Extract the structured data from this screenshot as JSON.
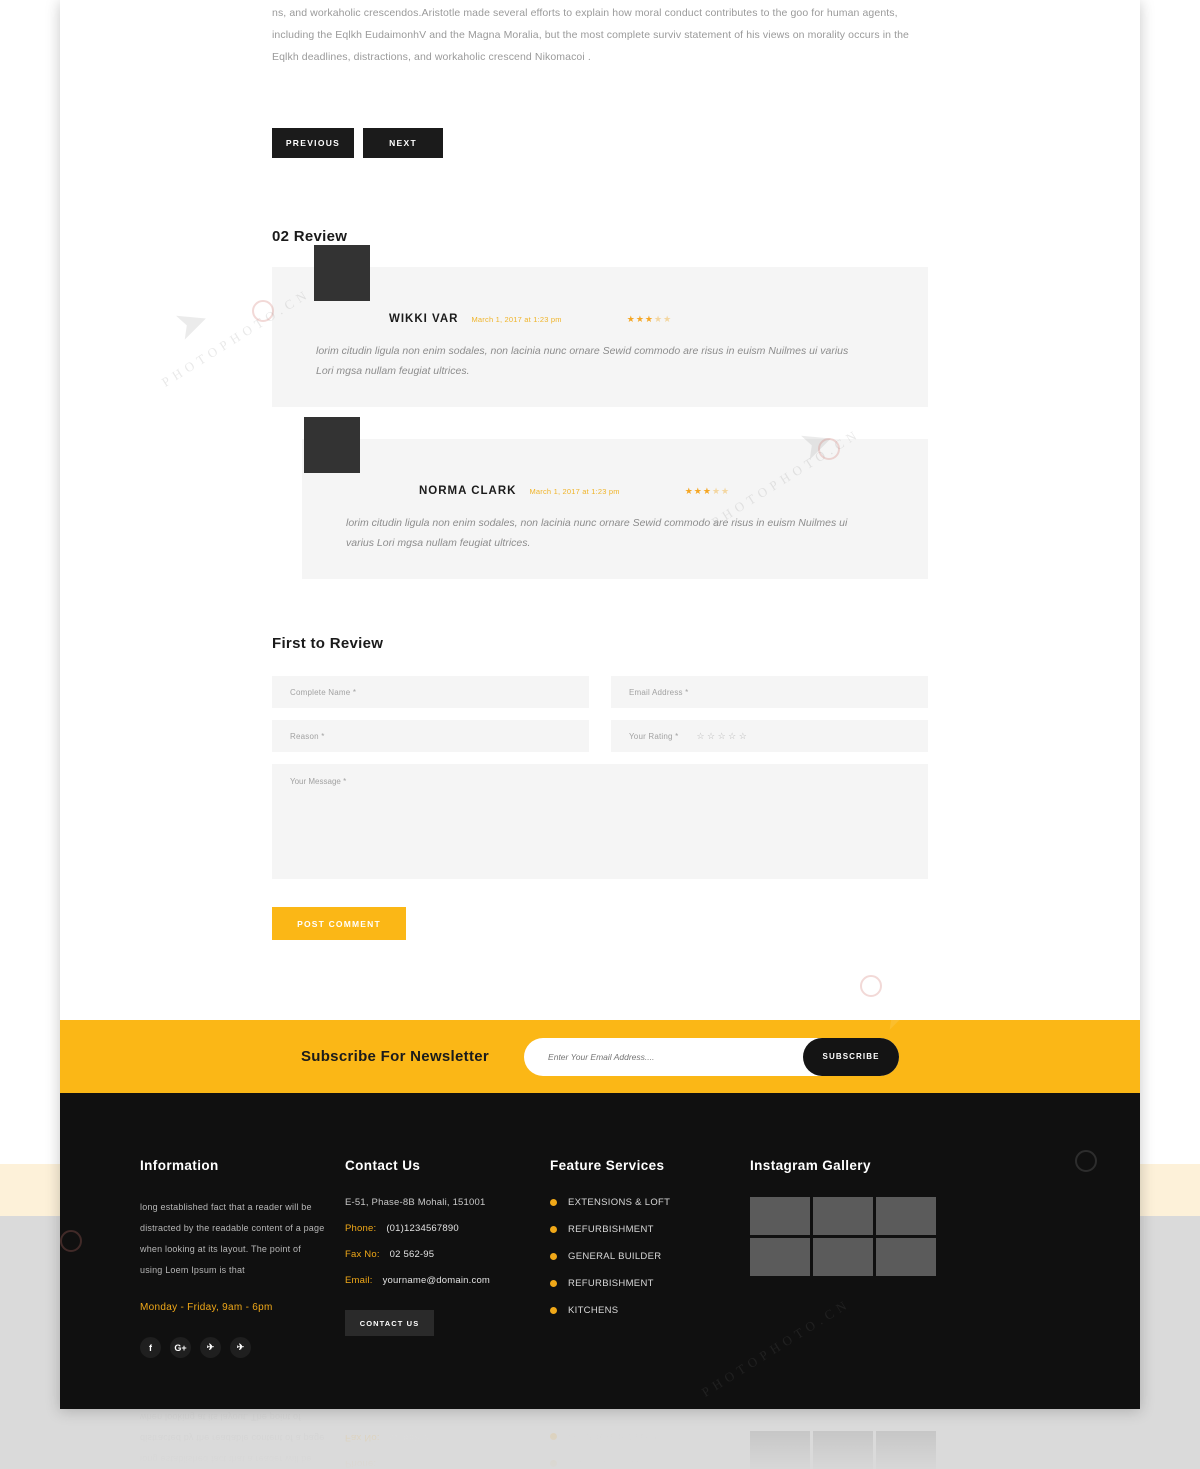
{
  "article": {
    "paragraph": "ns, and workaholic crescendos.Aristotle made several efforts to explain how moral conduct contributes to the goo for human agents, including the Eqlkh EudaimonhV and the Magna Moralia, but the most complete surviv statement of his views on morality occurs in the Eqlkh deadlines, distractions, and workaholic crescend Nikomacoi ."
  },
  "pager": {
    "previous_label": "PREVIOUS",
    "next_label": "NEXT"
  },
  "reviews": {
    "section_title": "02 Review",
    "items": [
      {
        "name": "WIKKI VAR",
        "date": "March 1, 2017 at 1:23 pm",
        "rating": 3,
        "max_rating": 5,
        "text": "lorim citudin ligula non enim sodales, non lacinia nunc ornare Sewid commodo are risus in euism Nuilmes ui varius Lori mgsa nullam feugiat ultrices."
      },
      {
        "name": "NORMA CLARK",
        "date": "March 1, 2017 at 1:23 pm",
        "rating": 3,
        "max_rating": 5,
        "text": "lorim citudin ligula non enim sodales, non lacinia nunc ornare Sewid commodo are risus in euism Nuilmes ui varius Lori mgsa nullam feugiat ultrices."
      }
    ]
  },
  "review_form": {
    "title": "First to Review",
    "name_placeholder": "Complete Name *",
    "email_placeholder": "Email Address *",
    "reason_placeholder": "Reason *",
    "rating_label": "Your Rating *",
    "rating_value": 0,
    "rating_max": 5,
    "message_placeholder": "Your Message *",
    "submit_label": "POST COMMENT",
    "submit_color": "#fbb716"
  },
  "newsletter": {
    "title": "Subscribe For Newsletter",
    "input_placeholder": "Enter Your Email Address....",
    "input_value": "",
    "button_label": "SUBSCRIBE",
    "background_color": "#fbb716"
  },
  "footer": {
    "information": {
      "title": "Information",
      "text": "long established fact that a reader will be distracted by the readable content of a page when looking at its layout. The point of using Loem Ipsum is that",
      "hours": "Monday - Friday, 9am - 6pm",
      "socials": [
        {
          "name": "facebook-icon",
          "glyph": "f"
        },
        {
          "name": "google-plus-icon",
          "glyph": "G+"
        },
        {
          "name": "twitter-icon",
          "glyph": "✈"
        },
        {
          "name": "twitter-alt-icon",
          "glyph": "✈"
        }
      ]
    },
    "contact": {
      "title": "Contact Us",
      "address": "E-51, Phase-8B Mohali, 151001",
      "rows": [
        {
          "label": "Phone:",
          "value": "(01)1234567890"
        },
        {
          "label": "Fax No:",
          "value": "02 562-95"
        },
        {
          "label": "Email:",
          "value": "yourname@domain.com"
        }
      ],
      "button_label": "CONTACT US"
    },
    "services": {
      "title": "Feature Services",
      "items": [
        "EXTENSIONS & LOFT",
        "REFURBISHMENT",
        "GENERAL BUILDER",
        "REFURBISHMENT",
        "KITCHENS"
      ]
    },
    "instagram": {
      "title": "Instagram Gallery",
      "cells": 6
    },
    "accent_color": "#f0a818",
    "background_color": "#101010"
  }
}
